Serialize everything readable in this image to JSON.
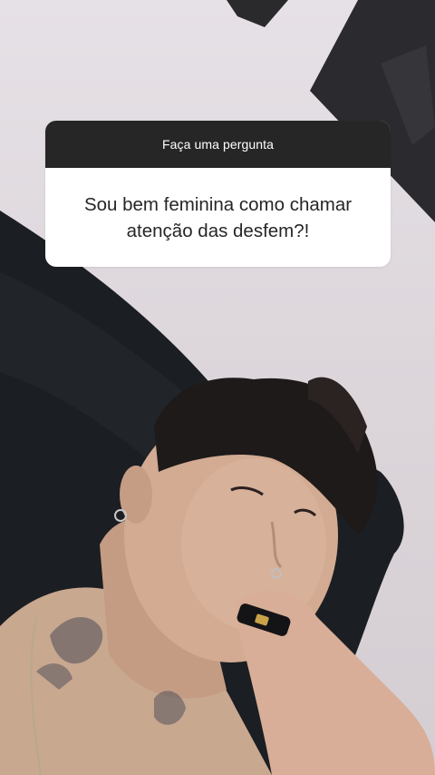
{
  "story": {
    "question_sticker": {
      "prompt": "Faça uma pergunta",
      "answer": "Sou bem feminina como chamar atenção das desfem?!"
    }
  },
  "colors": {
    "sticker_header_bg": "#262626",
    "sticker_body_bg": "#ffffff",
    "sticker_text": "#262626",
    "wall": "#e0dadf"
  }
}
